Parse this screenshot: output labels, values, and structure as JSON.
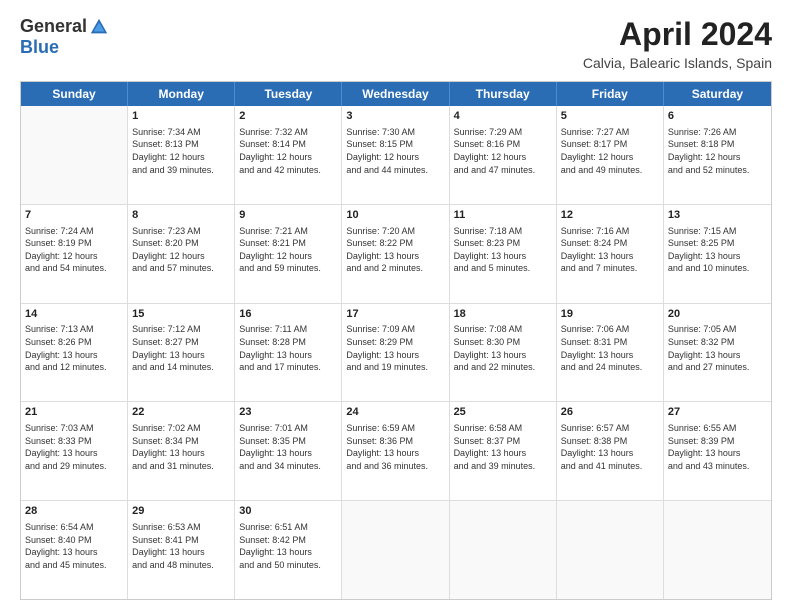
{
  "logo": {
    "general": "General",
    "blue": "Blue"
  },
  "title": "April 2024",
  "subtitle": "Calvia, Balearic Islands, Spain",
  "headers": [
    "Sunday",
    "Monday",
    "Tuesday",
    "Wednesday",
    "Thursday",
    "Friday",
    "Saturday"
  ],
  "weeks": [
    [
      {
        "day": "",
        "sunrise": "",
        "sunset": "",
        "daylight": ""
      },
      {
        "day": "1",
        "sunrise": "Sunrise: 7:34 AM",
        "sunset": "Sunset: 8:13 PM",
        "daylight": "Daylight: 12 hours and 39 minutes."
      },
      {
        "day": "2",
        "sunrise": "Sunrise: 7:32 AM",
        "sunset": "Sunset: 8:14 PM",
        "daylight": "Daylight: 12 hours and 42 minutes."
      },
      {
        "day": "3",
        "sunrise": "Sunrise: 7:30 AM",
        "sunset": "Sunset: 8:15 PM",
        "daylight": "Daylight: 12 hours and 44 minutes."
      },
      {
        "day": "4",
        "sunrise": "Sunrise: 7:29 AM",
        "sunset": "Sunset: 8:16 PM",
        "daylight": "Daylight: 12 hours and 47 minutes."
      },
      {
        "day": "5",
        "sunrise": "Sunrise: 7:27 AM",
        "sunset": "Sunset: 8:17 PM",
        "daylight": "Daylight: 12 hours and 49 minutes."
      },
      {
        "day": "6",
        "sunrise": "Sunrise: 7:26 AM",
        "sunset": "Sunset: 8:18 PM",
        "daylight": "Daylight: 12 hours and 52 minutes."
      }
    ],
    [
      {
        "day": "7",
        "sunrise": "Sunrise: 7:24 AM",
        "sunset": "Sunset: 8:19 PM",
        "daylight": "Daylight: 12 hours and 54 minutes."
      },
      {
        "day": "8",
        "sunrise": "Sunrise: 7:23 AM",
        "sunset": "Sunset: 8:20 PM",
        "daylight": "Daylight: 12 hours and 57 minutes."
      },
      {
        "day": "9",
        "sunrise": "Sunrise: 7:21 AM",
        "sunset": "Sunset: 8:21 PM",
        "daylight": "Daylight: 12 hours and 59 minutes."
      },
      {
        "day": "10",
        "sunrise": "Sunrise: 7:20 AM",
        "sunset": "Sunset: 8:22 PM",
        "daylight": "Daylight: 13 hours and 2 minutes."
      },
      {
        "day": "11",
        "sunrise": "Sunrise: 7:18 AM",
        "sunset": "Sunset: 8:23 PM",
        "daylight": "Daylight: 13 hours and 5 minutes."
      },
      {
        "day": "12",
        "sunrise": "Sunrise: 7:16 AM",
        "sunset": "Sunset: 8:24 PM",
        "daylight": "Daylight: 13 hours and 7 minutes."
      },
      {
        "day": "13",
        "sunrise": "Sunrise: 7:15 AM",
        "sunset": "Sunset: 8:25 PM",
        "daylight": "Daylight: 13 hours and 10 minutes."
      }
    ],
    [
      {
        "day": "14",
        "sunrise": "Sunrise: 7:13 AM",
        "sunset": "Sunset: 8:26 PM",
        "daylight": "Daylight: 13 hours and 12 minutes."
      },
      {
        "day": "15",
        "sunrise": "Sunrise: 7:12 AM",
        "sunset": "Sunset: 8:27 PM",
        "daylight": "Daylight: 13 hours and 14 minutes."
      },
      {
        "day": "16",
        "sunrise": "Sunrise: 7:11 AM",
        "sunset": "Sunset: 8:28 PM",
        "daylight": "Daylight: 13 hours and 17 minutes."
      },
      {
        "day": "17",
        "sunrise": "Sunrise: 7:09 AM",
        "sunset": "Sunset: 8:29 PM",
        "daylight": "Daylight: 13 hours and 19 minutes."
      },
      {
        "day": "18",
        "sunrise": "Sunrise: 7:08 AM",
        "sunset": "Sunset: 8:30 PM",
        "daylight": "Daylight: 13 hours and 22 minutes."
      },
      {
        "day": "19",
        "sunrise": "Sunrise: 7:06 AM",
        "sunset": "Sunset: 8:31 PM",
        "daylight": "Daylight: 13 hours and 24 minutes."
      },
      {
        "day": "20",
        "sunrise": "Sunrise: 7:05 AM",
        "sunset": "Sunset: 8:32 PM",
        "daylight": "Daylight: 13 hours and 27 minutes."
      }
    ],
    [
      {
        "day": "21",
        "sunrise": "Sunrise: 7:03 AM",
        "sunset": "Sunset: 8:33 PM",
        "daylight": "Daylight: 13 hours and 29 minutes."
      },
      {
        "day": "22",
        "sunrise": "Sunrise: 7:02 AM",
        "sunset": "Sunset: 8:34 PM",
        "daylight": "Daylight: 13 hours and 31 minutes."
      },
      {
        "day": "23",
        "sunrise": "Sunrise: 7:01 AM",
        "sunset": "Sunset: 8:35 PM",
        "daylight": "Daylight: 13 hours and 34 minutes."
      },
      {
        "day": "24",
        "sunrise": "Sunrise: 6:59 AM",
        "sunset": "Sunset: 8:36 PM",
        "daylight": "Daylight: 13 hours and 36 minutes."
      },
      {
        "day": "25",
        "sunrise": "Sunrise: 6:58 AM",
        "sunset": "Sunset: 8:37 PM",
        "daylight": "Daylight: 13 hours and 39 minutes."
      },
      {
        "day": "26",
        "sunrise": "Sunrise: 6:57 AM",
        "sunset": "Sunset: 8:38 PM",
        "daylight": "Daylight: 13 hours and 41 minutes."
      },
      {
        "day": "27",
        "sunrise": "Sunrise: 6:55 AM",
        "sunset": "Sunset: 8:39 PM",
        "daylight": "Daylight: 13 hours and 43 minutes."
      }
    ],
    [
      {
        "day": "28",
        "sunrise": "Sunrise: 6:54 AM",
        "sunset": "Sunset: 8:40 PM",
        "daylight": "Daylight: 13 hours and 45 minutes."
      },
      {
        "day": "29",
        "sunrise": "Sunrise: 6:53 AM",
        "sunset": "Sunset: 8:41 PM",
        "daylight": "Daylight: 13 hours and 48 minutes."
      },
      {
        "day": "30",
        "sunrise": "Sunrise: 6:51 AM",
        "sunset": "Sunset: 8:42 PM",
        "daylight": "Daylight: 13 hours and 50 minutes."
      },
      {
        "day": "",
        "sunrise": "",
        "sunset": "",
        "daylight": ""
      },
      {
        "day": "",
        "sunrise": "",
        "sunset": "",
        "daylight": ""
      },
      {
        "day": "",
        "sunrise": "",
        "sunset": "",
        "daylight": ""
      },
      {
        "day": "",
        "sunrise": "",
        "sunset": "",
        "daylight": ""
      }
    ]
  ]
}
